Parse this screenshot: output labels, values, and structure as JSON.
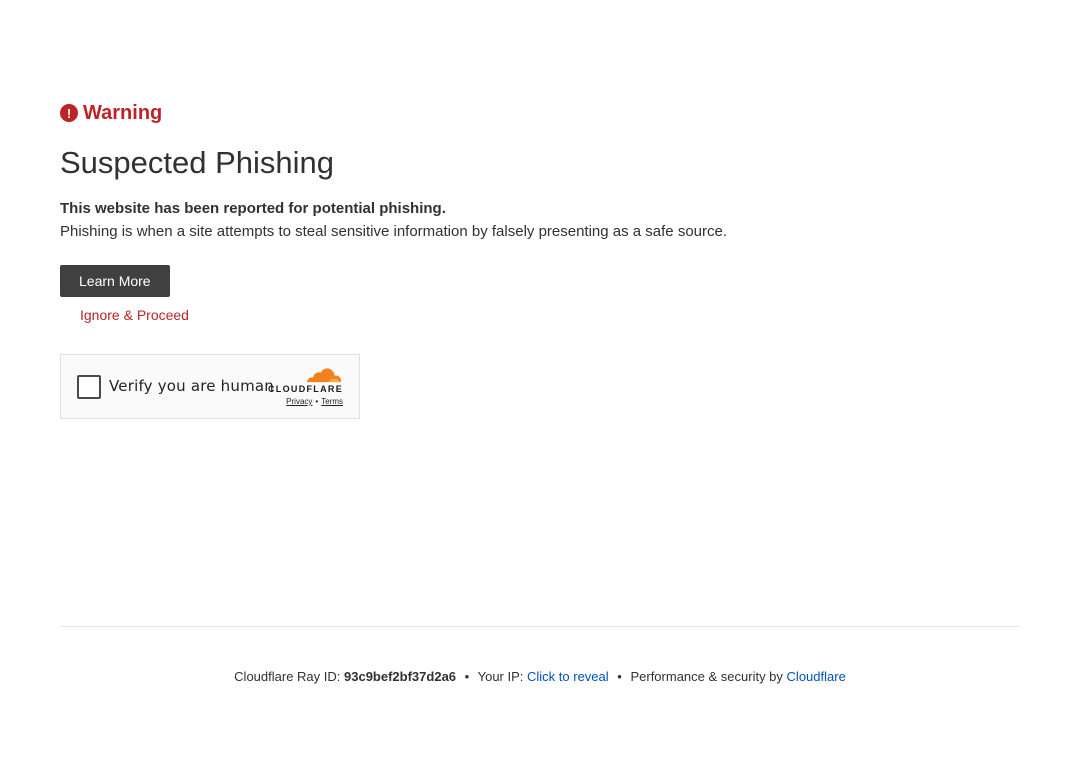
{
  "warning": {
    "icon": "exclamation-circle-icon",
    "icon_glyph": "!",
    "label": "Warning",
    "color": "#bd2426"
  },
  "heading": "Suspected Phishing",
  "message": {
    "bold": "This website has been reported for potential phishing.",
    "description": "Phishing is when a site attempts to steal sensitive information by falsely presenting as a safe source."
  },
  "actions": {
    "learn_more": "Learn More",
    "ignore_proceed": "Ignore & Proceed"
  },
  "turnstile": {
    "label": "Verify you are human",
    "brand": "CLOUDFLARE",
    "brand_icon": "cloudflare-cloud-icon",
    "privacy": "Privacy",
    "separator": "•",
    "terms": "Terms",
    "brand_color": "#f48120"
  },
  "footer": {
    "ray_label": "Cloudflare Ray ID:",
    "ray_id": "93c9bef2bf37d2a6",
    "bullet": "•",
    "ip_label": "Your IP:",
    "ip_reveal": "Click to reveal",
    "perf_label": "Performance & security by",
    "perf_link": "Cloudflare",
    "link_color": "#0051c3"
  }
}
